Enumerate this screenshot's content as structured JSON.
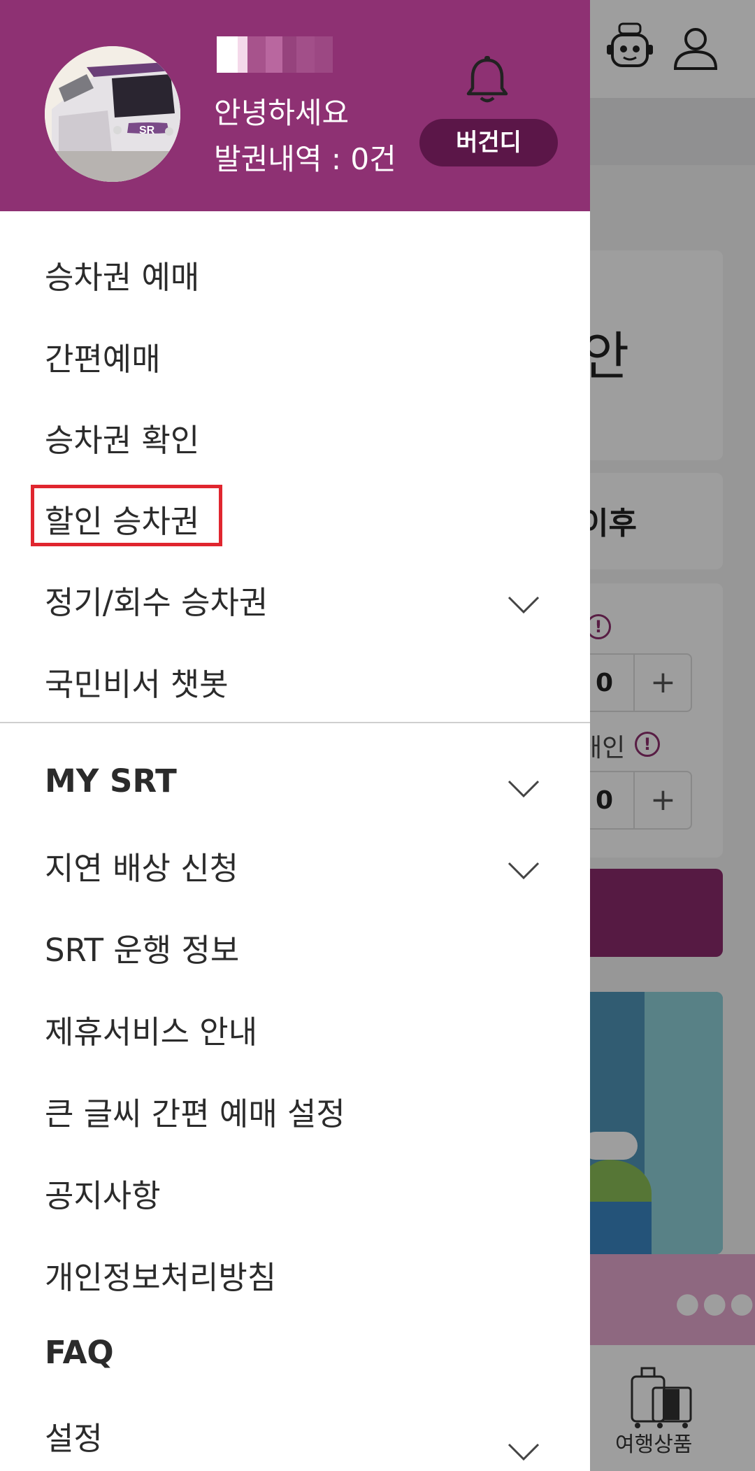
{
  "background": {
    "fragment_title": "안",
    "fragment_after": "이후",
    "fragment_discount": "애인",
    "stepper_values": [
      "0",
      "0"
    ],
    "nav_label": "여행상품",
    "icons": [
      "chatbot-icon",
      "user-icon",
      "alert-icon",
      "plus-icon",
      "more-dots-icon",
      "luggage-icon"
    ]
  },
  "drawer": {
    "header": {
      "greeting": "안녕하세요",
      "ticket_count": "발권내역 : 0건",
      "theme_button": "버건디",
      "bell_icon": "bell-icon",
      "header_color": "#8e3173",
      "button_color": "#5b1648"
    },
    "menu_primary": [
      {
        "label": "승차권 예매"
      },
      {
        "label": "간편예매"
      },
      {
        "label": "승차권 확인"
      },
      {
        "label": "할인 승차권",
        "highlighted": true
      },
      {
        "label": "정기/회수 승차권",
        "expandable": true
      },
      {
        "label": "국민비서 챗봇"
      }
    ],
    "menu_secondary": [
      {
        "label": "MY SRT",
        "expandable": true
      },
      {
        "label": "지연 배상 신청",
        "expandable": true
      },
      {
        "label": "SRT 운행 정보"
      },
      {
        "label": "제휴서비스 안내"
      },
      {
        "label": "큰 글씨 간편 예매 설정"
      },
      {
        "label": "공지사항"
      },
      {
        "label": "개인정보처리방침"
      },
      {
        "label": "FAQ"
      },
      {
        "label": "설정",
        "expandable": true
      }
    ],
    "highlight_color": "#e0262f"
  }
}
